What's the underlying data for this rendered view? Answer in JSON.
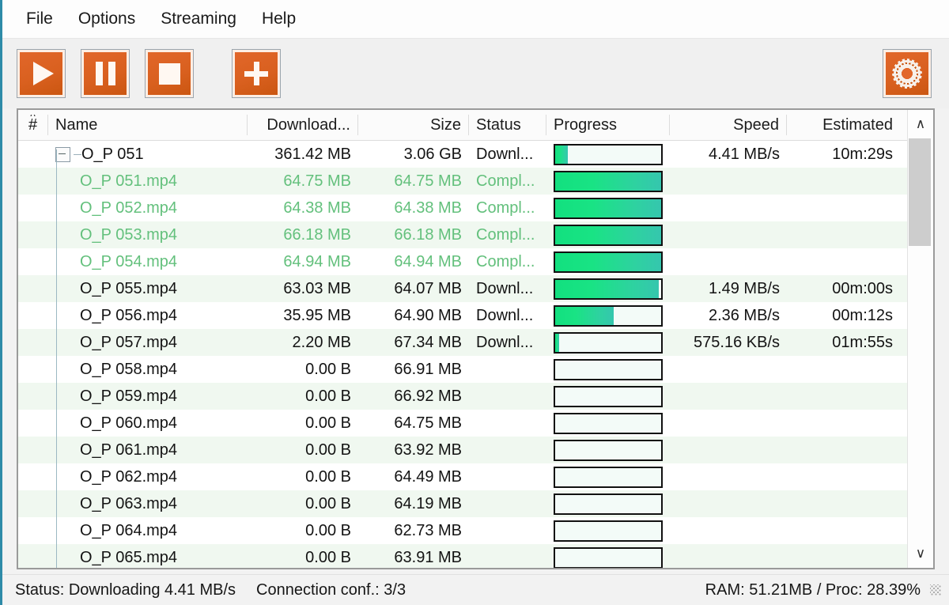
{
  "menu": {
    "items": [
      {
        "label": "File"
      },
      {
        "label": "Options"
      },
      {
        "label": "Streaming"
      },
      {
        "label": "Help"
      }
    ]
  },
  "toolbar": {
    "buttons": [
      {
        "name": "start-button",
        "icon": "play-icon"
      },
      {
        "name": "pause-button",
        "icon": "pause-icon"
      },
      {
        "name": "stop-button",
        "icon": "stop-icon"
      },
      {
        "name": "add-button",
        "icon": "plus-icon"
      }
    ],
    "settings_button": {
      "name": "settings-button",
      "icon": "gear-icon"
    },
    "accent_color": "#d9601f"
  },
  "table": {
    "headers": {
      "num": "#",
      "name": "Name",
      "downloaded": "Download...",
      "size": "Size",
      "status": "Status",
      "progress": "Progress",
      "speed": "Speed",
      "estimated": "Estimated"
    },
    "sort_indicator": "∧",
    "rows": [
      {
        "name": "O_P 051",
        "downloaded": "361.42 MB",
        "size": "3.06 GB",
        "status": "Downl...",
        "progress": 12,
        "speed": "4.41 MB/s",
        "estimated": "10m:29s",
        "state": "downloading",
        "type": "parent"
      },
      {
        "name": "O_P 051.mp4",
        "downloaded": "64.75 MB",
        "size": "64.75 MB",
        "status": "Compl...",
        "progress": 100,
        "speed": "",
        "estimated": "",
        "state": "completed",
        "type": "child"
      },
      {
        "name": "O_P 052.mp4",
        "downloaded": "64.38 MB",
        "size": "64.38 MB",
        "status": "Compl...",
        "progress": 100,
        "speed": "",
        "estimated": "",
        "state": "completed",
        "type": "child"
      },
      {
        "name": "O_P 053.mp4",
        "downloaded": "66.18 MB",
        "size": "66.18 MB",
        "status": "Compl...",
        "progress": 100,
        "speed": "",
        "estimated": "",
        "state": "completed",
        "type": "child"
      },
      {
        "name": "O_P 054.mp4",
        "downloaded": "64.94 MB",
        "size": "64.94 MB",
        "status": "Compl...",
        "progress": 100,
        "speed": "",
        "estimated": "",
        "state": "completed",
        "type": "child"
      },
      {
        "name": "O_P 055.mp4",
        "downloaded": "63.03 MB",
        "size": "64.07 MB",
        "status": "Downl...",
        "progress": 98,
        "speed": "1.49 MB/s",
        "estimated": "00m:00s",
        "state": "downloading",
        "type": "child"
      },
      {
        "name": "O_P 056.mp4",
        "downloaded": "35.95 MB",
        "size": "64.90 MB",
        "status": "Downl...",
        "progress": 55,
        "speed": "2.36 MB/s",
        "estimated": "00m:12s",
        "state": "downloading",
        "type": "child"
      },
      {
        "name": "O_P 057.mp4",
        "downloaded": "2.20 MB",
        "size": "67.34 MB",
        "status": "Downl...",
        "progress": 4,
        "speed": "575.16 KB/s",
        "estimated": "01m:55s",
        "state": "downloading",
        "type": "child"
      },
      {
        "name": "O_P 058.mp4",
        "downloaded": "0.00 B",
        "size": "66.91 MB",
        "status": "",
        "progress": 0,
        "speed": "",
        "estimated": "",
        "state": "queued",
        "type": "child"
      },
      {
        "name": "O_P 059.mp4",
        "downloaded": "0.00 B",
        "size": "66.92 MB",
        "status": "",
        "progress": 0,
        "speed": "",
        "estimated": "",
        "state": "queued",
        "type": "child"
      },
      {
        "name": "O_P 060.mp4",
        "downloaded": "0.00 B",
        "size": "64.75 MB",
        "status": "",
        "progress": 0,
        "speed": "",
        "estimated": "",
        "state": "queued",
        "type": "child"
      },
      {
        "name": "O_P 061.mp4",
        "downloaded": "0.00 B",
        "size": "63.92 MB",
        "status": "",
        "progress": 0,
        "speed": "",
        "estimated": "",
        "state": "queued",
        "type": "child"
      },
      {
        "name": "O_P 062.mp4",
        "downloaded": "0.00 B",
        "size": "64.49 MB",
        "status": "",
        "progress": 0,
        "speed": "",
        "estimated": "",
        "state": "queued",
        "type": "child"
      },
      {
        "name": "O_P 063.mp4",
        "downloaded": "0.00 B",
        "size": "64.19 MB",
        "status": "",
        "progress": 0,
        "speed": "",
        "estimated": "",
        "state": "queued",
        "type": "child"
      },
      {
        "name": "O_P 064.mp4",
        "downloaded": "0.00 B",
        "size": "62.73 MB",
        "status": "",
        "progress": 0,
        "speed": "",
        "estimated": "",
        "state": "queued",
        "type": "child"
      },
      {
        "name": "O_P 065.mp4",
        "downloaded": "0.00 B",
        "size": "63.91 MB",
        "status": "",
        "progress": 0,
        "speed": "",
        "estimated": "",
        "state": "queued",
        "type": "child"
      }
    ]
  },
  "scrollbar": {
    "up_arrow": "∧",
    "down_arrow": "∨"
  },
  "statusbar": {
    "status": "Status: Downloading 4.41 MB/s",
    "connection": "Connection conf.: 3/3",
    "resources": "RAM: 51.21MB / Proc: 28.39%"
  },
  "colors": {
    "accent": "#d9601f",
    "progress_green": "#12e07f",
    "completed_text": "#63c07c"
  }
}
